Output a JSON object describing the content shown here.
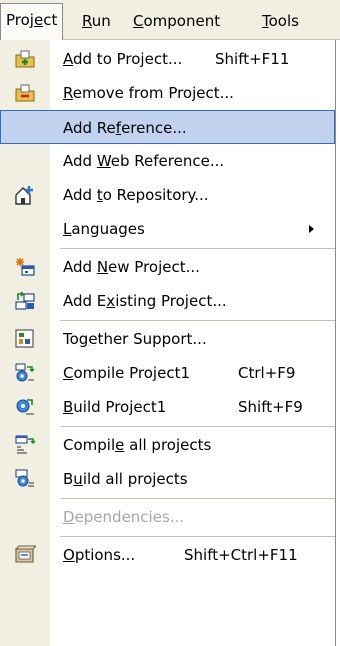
{
  "menubar": {
    "items": [
      {
        "pre": "Proj",
        "u": "e",
        "post": "ct"
      },
      {
        "pre": "",
        "u": "R",
        "post": "un"
      },
      {
        "pre": "",
        "u": "C",
        "post": "omponent"
      },
      {
        "pre": "",
        "u": "T",
        "post": "ools"
      }
    ]
  },
  "menu": {
    "items": [
      {
        "pre": "",
        "u": "A",
        "post": "dd to Project...",
        "shortcut": "Shift+F11"
      },
      {
        "pre": "",
        "u": "R",
        "post": "emove from Project...",
        "shortcut": ""
      },
      {
        "pre": "Add Re",
        "u": "f",
        "post": "erence...",
        "shortcut": ""
      },
      {
        "pre": "Add ",
        "u": "W",
        "post": "eb Reference...",
        "shortcut": ""
      },
      {
        "pre": "Add ",
        "u": "t",
        "post": "o Repository...",
        "shortcut": ""
      },
      {
        "pre": "",
        "u": "L",
        "post": "anguages",
        "shortcut": ""
      },
      {
        "pre": "Add ",
        "u": "N",
        "post": "ew Project...",
        "shortcut": ""
      },
      {
        "pre": "Add E",
        "u": "x",
        "post": "isting Project...",
        "shortcut": ""
      },
      {
        "pre": "To",
        "u": "g",
        "post": "ether Support...",
        "shortcut": ""
      },
      {
        "pre": "",
        "u": "C",
        "post": "ompile Project1",
        "shortcut": "Ctrl+F9"
      },
      {
        "pre": "",
        "u": "B",
        "post": "uild Project1",
        "shortcut": "Shift+F9"
      },
      {
        "pre": "Compil",
        "u": "e",
        "post": " all projects",
        "shortcut": ""
      },
      {
        "pre": "B",
        "u": "u",
        "post": "ild all projects",
        "shortcut": ""
      },
      {
        "pre": "",
        "u": "D",
        "post": "ependencies...",
        "shortcut": ""
      },
      {
        "pre": "",
        "u": "O",
        "post": "ptions...",
        "shortcut": "Shift+Ctrl+F11"
      }
    ]
  }
}
